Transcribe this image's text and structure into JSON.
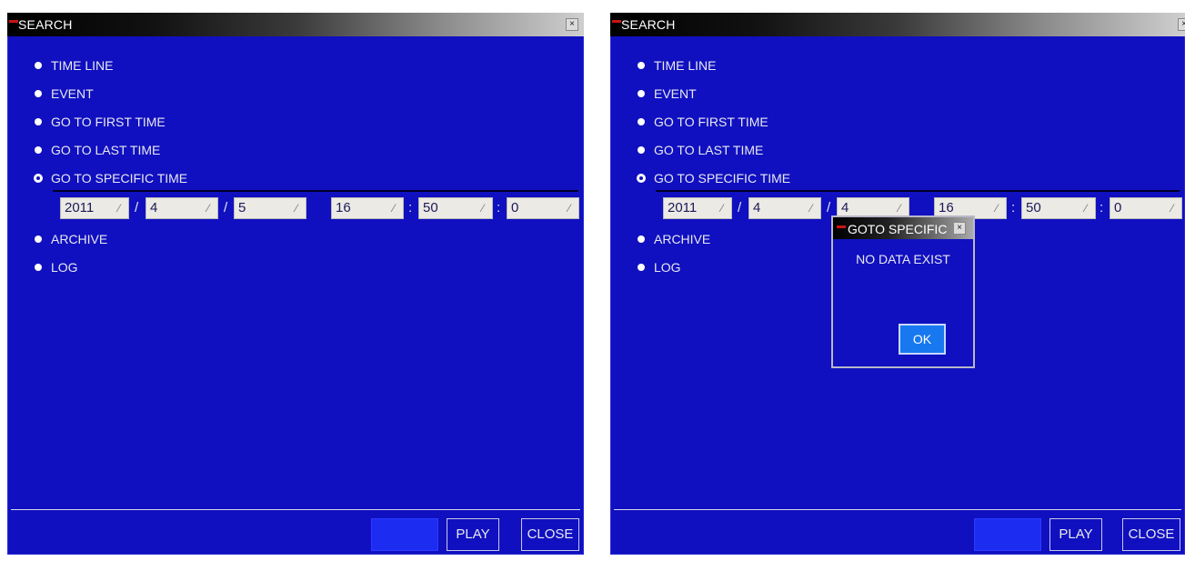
{
  "window": {
    "title": "SEARCH",
    "close": "×"
  },
  "menu": {
    "time_line": "TIME LINE",
    "event": "EVENT",
    "first_time": "GO TO FIRST TIME",
    "last_time": "GO TO LAST TIME",
    "specific_time": "GO TO SPECIFIC TIME",
    "archive": "ARCHIVE",
    "log": "LOG"
  },
  "left_time": {
    "year": "2011",
    "month": "4",
    "day": "5",
    "hour": "16",
    "minute": "50",
    "second": "0"
  },
  "right_time": {
    "year": "2011",
    "month": "4",
    "day": "4",
    "hour": "16",
    "minute": "50",
    "second": "0"
  },
  "separators": {
    "date": "/",
    "time": ":"
  },
  "spin_glyph": "⁄",
  "buttons": {
    "play": "PLAY",
    "close": "CLOSE"
  },
  "dialog": {
    "title": "GOTO SPECIFIC TIME",
    "close": "×",
    "message": "NO DATA EXIST",
    "ok": "OK"
  },
  "colors": {
    "panel_bg": "#1010c0",
    "accent_red": "#c81414",
    "ok_button": "#1878f0"
  }
}
